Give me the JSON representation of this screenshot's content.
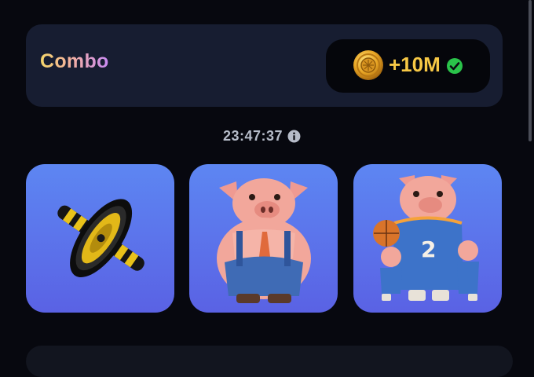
{
  "combo": {
    "title": "Combo",
    "reward": "+10M",
    "reward_status": "claimed",
    "coin_icon": "coin-icon",
    "check_icon": "check-circle-icon"
  },
  "timer": {
    "value": "23:47:37",
    "info_icon": "info-icon"
  },
  "cards": [
    {
      "icon": "ab-roller-icon"
    },
    {
      "icon": "pig-in-overalls-icon"
    },
    {
      "icon": "basketball-pig-family-icon"
    }
  ],
  "colors": {
    "background": "#07080f",
    "panel": "#171d31",
    "reward_text": "#f7c845",
    "check": "#2ac34a",
    "card_gradient_top": "#5d86f2",
    "card_gradient_bottom": "#5a62e4"
  }
}
